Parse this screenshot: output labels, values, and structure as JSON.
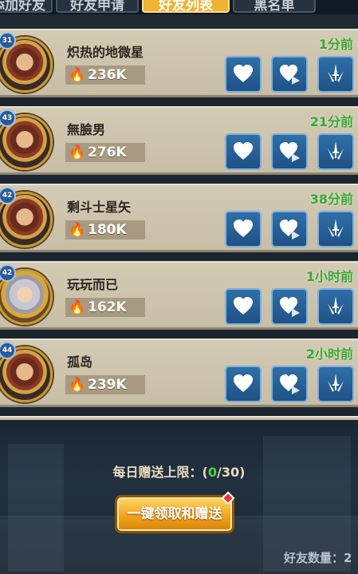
{
  "tabs": [
    {
      "label": "添加好友",
      "active": false
    },
    {
      "label": "好友申请",
      "active": false
    },
    {
      "label": "好友列表",
      "active": true
    },
    {
      "label": "黑名单",
      "active": false
    }
  ],
  "friends": [
    {
      "level": "31",
      "name": "炽热的地微星",
      "power": "236K",
      "time": "1分前"
    },
    {
      "level": "43",
      "name": "無臉男",
      "power": "276K",
      "time": "21分前"
    },
    {
      "level": "42",
      "name": "剩斗士星矢",
      "power": "180K",
      "time": "38分前"
    },
    {
      "level": "42",
      "name": "玩玩而已",
      "power": "162K",
      "time": "1小时前"
    },
    {
      "level": "44",
      "name": "孤岛",
      "power": "239K",
      "time": "2小时前"
    }
  ],
  "daily_limit": {
    "label": "每日赠送上限：(",
    "current": "0",
    "max": "/30)"
  },
  "claim_button": "一键领取和赠送",
  "friend_count_label": "好友数量：2",
  "colors": {
    "tab_active": "#f0b232",
    "time_green": "#3ea43a",
    "button_blue": "#2f6fa8"
  },
  "icons": [
    "heart-icon",
    "heart-send-icon",
    "swords-icon",
    "flame-icon"
  ]
}
